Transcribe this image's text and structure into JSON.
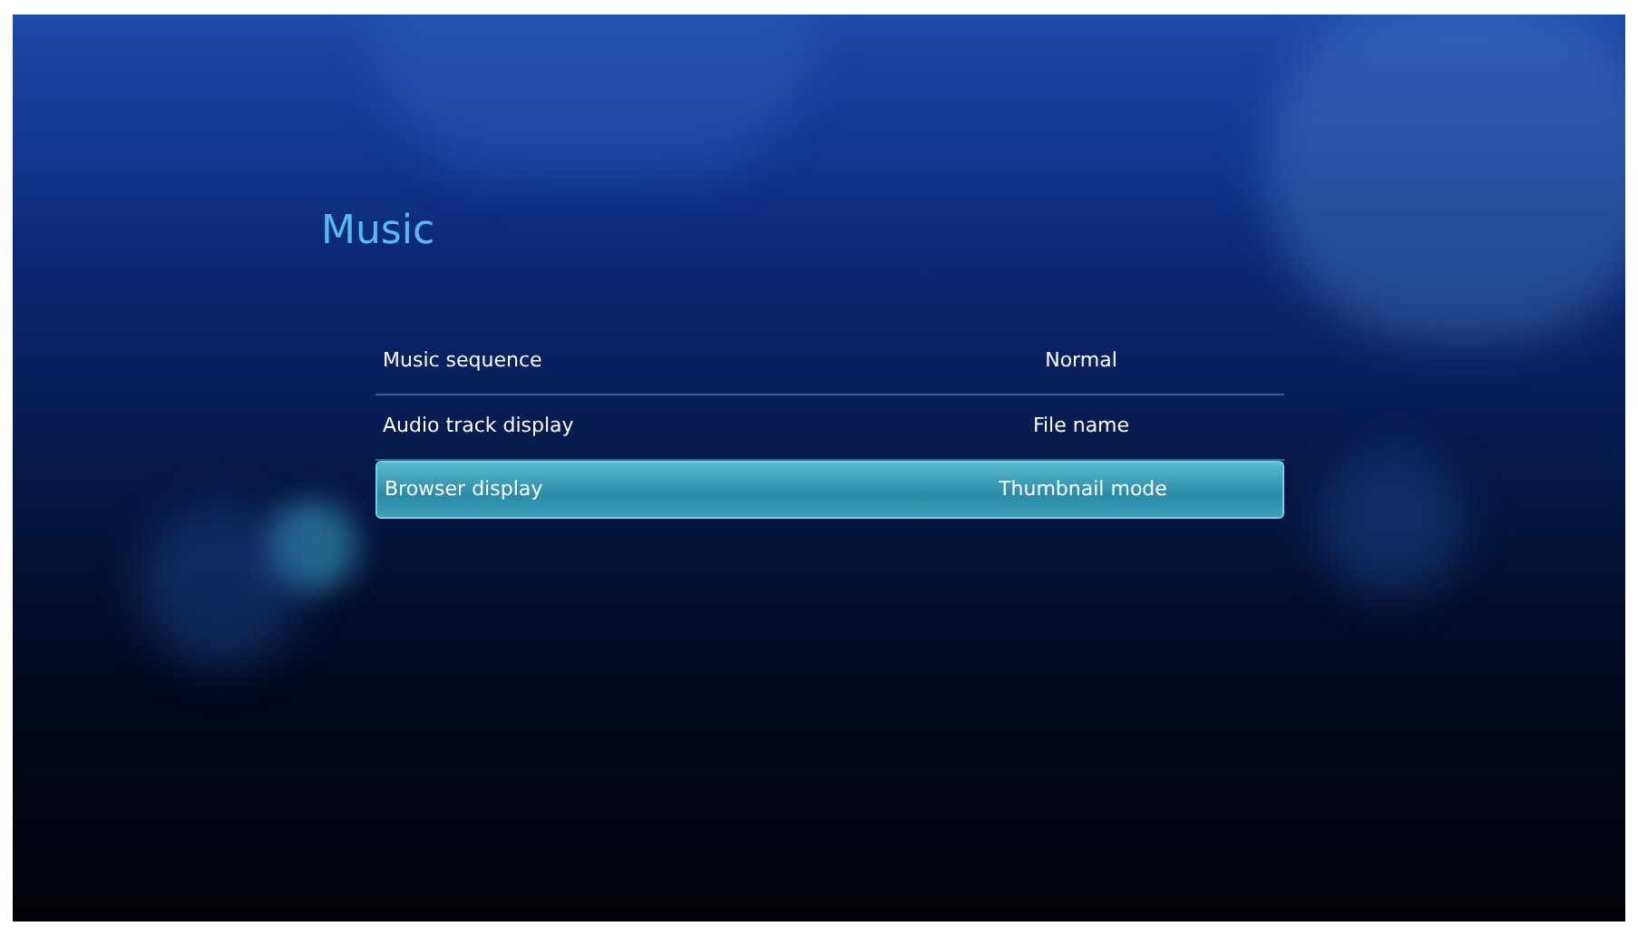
{
  "title": "Music",
  "settings": [
    {
      "label": "Music sequence",
      "value": "Normal",
      "selected": false
    },
    {
      "label": "Audio track display",
      "value": "File name",
      "selected": false
    },
    {
      "label": "Browser display",
      "value": "Thumbnail mode",
      "selected": true
    }
  ]
}
